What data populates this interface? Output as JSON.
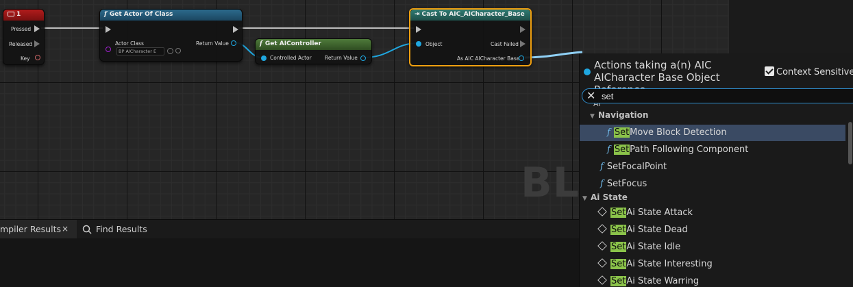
{
  "graph": {
    "watermark": "BLU",
    "nodes": {
      "key_event": {
        "title": "1",
        "pins": {
          "pressed": "Pressed",
          "released": "Released",
          "key": "Key"
        }
      },
      "get_actor_of_class": {
        "title": "Get Actor Of Class",
        "actor_class_label": "Actor Class",
        "actor_class_value": "BP AICharacter E",
        "return_label": "Return Value"
      },
      "get_ai_controller": {
        "title": "Get AIController",
        "controlled_actor_label": "Controlled Actor",
        "return_label": "Return Value"
      },
      "cast_to": {
        "title": "Cast To AIC_AICharacter_Base",
        "object_label": "Object",
        "cast_failed_label": "Cast Failed",
        "as_label": "As AIC AICharacter Base"
      }
    },
    "colors": {
      "exec_wire": "#bdbdbd",
      "object_wire": "#1fa7e0",
      "cast_border": "#f0a010"
    }
  },
  "bottom_tabs": {
    "compiler_results": "mpiler Results",
    "close": "×",
    "find_results": "Find Results"
  },
  "action_menu": {
    "title": "Actions taking a(n) AIC AICharacter Base Object Reference",
    "context_sensitive_label": "Context Sensitive",
    "context_sensitive_checked": true,
    "search_value": "set",
    "highlight": "Set",
    "cut_category": "AI",
    "items": [
      {
        "kind": "category",
        "label": "Navigation"
      },
      {
        "kind": "function",
        "highlight": "Set",
        "rest": "Move Block Detection",
        "selected": true
      },
      {
        "kind": "function",
        "highlight": "Set",
        "rest": "Path Following Component"
      },
      {
        "kind": "function",
        "label": "SetFocalPoint"
      },
      {
        "kind": "function",
        "label": "SetFocus"
      },
      {
        "kind": "category",
        "label": "Ai State"
      },
      {
        "kind": "variable",
        "highlight": "Set",
        "rest": "Ai State Attack"
      },
      {
        "kind": "variable",
        "highlight": "Set",
        "rest": "Ai State Dead"
      },
      {
        "kind": "variable",
        "highlight": "Set",
        "rest": "Ai State Idle"
      },
      {
        "kind": "variable",
        "highlight": "Set",
        "rest": "Ai State Interesting"
      },
      {
        "kind": "variable",
        "highlight": "Set",
        "rest": "Ai State Warring"
      }
    ]
  }
}
